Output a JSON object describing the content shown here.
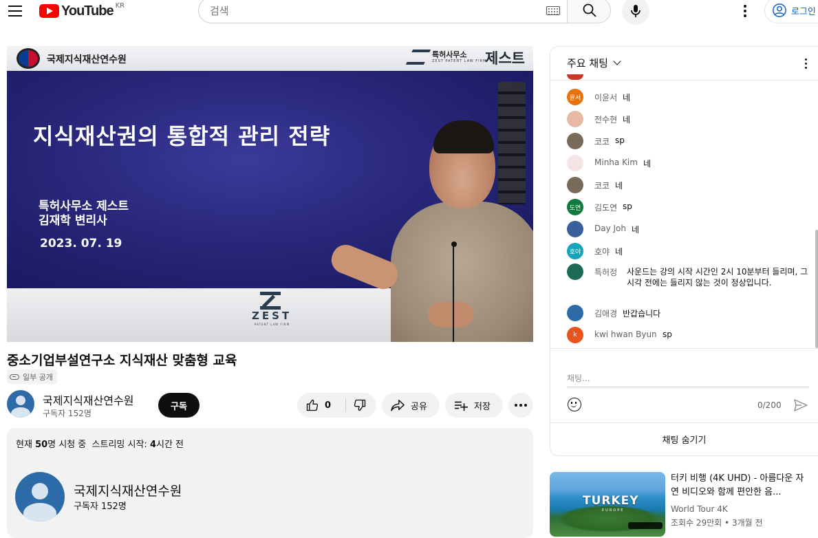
{
  "masthead": {
    "logo_text": "YouTube",
    "country_code": "KR",
    "search_placeholder": "검색",
    "login_label": "로그인"
  },
  "player": {
    "slide": {
      "org_name": "국제지식재산연수원",
      "firm_small": "특허사무소",
      "firm_en": "ZEST PATENT LAW FIRM",
      "firm_big": "제스트",
      "title": "지식재산권의 통합적 관리 전략",
      "presenter_line1": "특허사무소 제스트",
      "presenter_line2": "김재학 변리사",
      "date": "2023. 07. 19",
      "footer_logo": "ZEST",
      "footer_sub": "PATENT LAW FIRM"
    }
  },
  "video": {
    "title": "중소기업부설연구소 지식재산 맞춤형 교육",
    "privacy": "일부 공개",
    "channel_name": "국제지식재산연수원",
    "subscribers": "구독자 152명",
    "subscribe_label": "구독",
    "like_count": "0",
    "share_label": "공유",
    "save_label": "저장"
  },
  "description": {
    "viewers_prefix": "현재 ",
    "viewers_count": "50",
    "viewers_suffix": "명 시청 중",
    "stream_prefix": "스트리밍 시작: ",
    "stream_hours": "4",
    "stream_suffix": "시간 전",
    "channel_name": "국제지식재산연수원",
    "subscribers": "구독자 152명"
  },
  "chat": {
    "header": "주요 채팅",
    "messages": [
      {
        "author": "이윤서",
        "text": "네",
        "avatar_text": "윤서",
        "avatar_color": "#e8710a"
      },
      {
        "author": "전수현",
        "text": "네",
        "avatar_text": "",
        "avatar_color": "#e7b9a5"
      },
      {
        "author": "코코",
        "text": "sp",
        "avatar_text": "",
        "avatar_color": "#7a6a5a"
      },
      {
        "author": "Minha Kim",
        "text": "네",
        "avatar_text": "",
        "avatar_color": "#f5e3e6"
      },
      {
        "author": "코코",
        "text": "네",
        "avatar_text": "",
        "avatar_color": "#7a6a5a"
      },
      {
        "author": "김도연",
        "text": "sp",
        "avatar_text": "도연",
        "avatar_color": "#0f7b3e"
      },
      {
        "author": "Day Joh",
        "text": "네",
        "avatar_text": "",
        "avatar_color": "#3a5f9a"
      },
      {
        "author": "호야",
        "text": "네",
        "avatar_text": "호야",
        "avatar_color": "#12a4b8"
      },
      {
        "author": "특허정",
        "text": "사운드는 강의 시작 시간인 2시 10분부터 들리며, 그 시각 전에는 들리지 않는 것이 정상입니다.",
        "avatar_text": "",
        "avatar_color": "#1d6b57"
      },
      {
        "author": "김애경",
        "text": "반갑습니다",
        "avatar_text": "",
        "avatar_color": "#2d6aa8"
      },
      {
        "author": "kwi hwan Byun",
        "text": "sp",
        "avatar_text": "k",
        "avatar_color": "#e8541e"
      }
    ],
    "input_placeholder": "채팅...",
    "char_count": "0/200",
    "hide_label": "채팅 숨기기"
  },
  "recommendation": {
    "thumb_title": "TURKEY",
    "thumb_sub": "EUROPE",
    "title": "터키 비행 (4K UHD) - 아름다운 자연 비디오와 함께 편안한 음...",
    "channel": "World Tour 4K",
    "meta": "조회수 29만회 • 3개월 전"
  },
  "icons": {
    "menu": "hamburger-menu-icon",
    "keyboard": "keyboard-icon",
    "search": "search-icon",
    "mic": "microphone-icon",
    "more": "more-vertical-icon",
    "account": "account-circle-icon",
    "link": "link-icon",
    "like": "thumbs-up-icon",
    "dislike": "thumbs-down-icon",
    "share": "share-arrow-icon",
    "save": "playlist-add-icon",
    "emoji": "emoji-smile-icon",
    "send": "send-icon"
  },
  "colors": {
    "brand_red": "#ff0000",
    "link_blue": "#065fd4",
    "subscribe_black": "#0f0f0f"
  }
}
